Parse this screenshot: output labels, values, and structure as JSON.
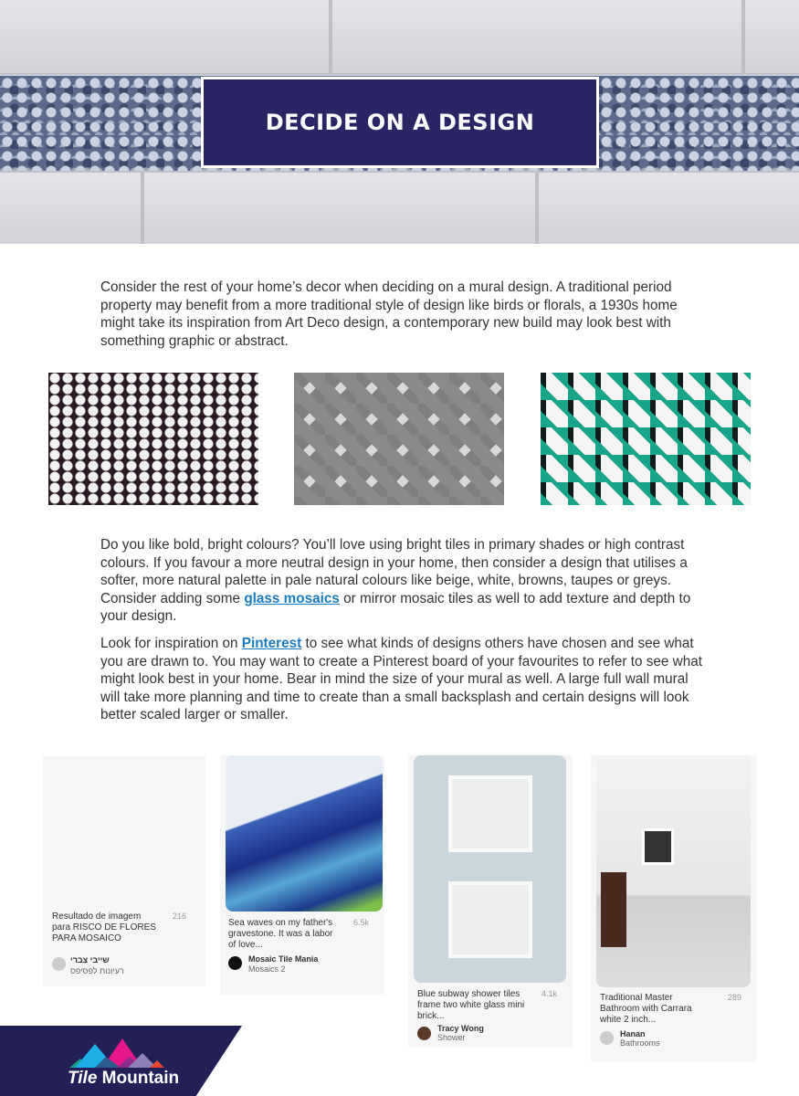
{
  "header": {
    "title": "DECIDE ON A DESIGN"
  },
  "paragraphs": {
    "p1": "Consider the rest of your home’s decor when deciding on a mural design. A traditional period property may benefit from a more traditional style of design like birds or florals, a 1930s home might take its inspiration from Art Deco design, a contemporary new build may look best with something graphic or abstract.",
    "p2_a": "Do you like bold, bright colours? You’ll love using bright tiles in primary shades or high contrast colours. If you favour a more neutral design in your home, then consider a design that utilises a softer, more natural palette in pale natural colours like beige, white, browns, taupes or greys. Consider adding some ",
    "p2_link": "glass mosaics",
    "p2_b": " or mirror mosaic tiles as well to add texture and depth to your design.",
    "p3_a": "Look for inspiration on ",
    "p3_link": "Pinterest",
    "p3_b": " to see what kinds of designs others have chosen and see what you are drawn to. You may want to create a Pinterest board of your favourites to refer to see what might look best in your home. Bear in mind the size of your mural as well. A large full wall mural will take more planning and time to create than a small backsplash and certain designs will look better scaled larger or smaller."
  },
  "pins": [
    {
      "caption": "Resultado de imagem para RISCO DE FLORES PARA MOSAICO",
      "count": "216",
      "user": "שייבי צברי",
      "board": "רעיונות לפסיפס"
    },
    {
      "caption": "Sea waves on my father's gravestone. It was a labor of love...",
      "count": "6.5k",
      "user": "Mosaic Tile Mania",
      "board": "Mosaics 2"
    },
    {
      "caption": "Blue subway shower tiles frame two white glass mini brick...",
      "count": "4.1k",
      "user": "Tracy Wong",
      "board": "Shower"
    },
    {
      "caption": "Traditional Master Bathroom with Carrara white 2 inch...",
      "count": "289",
      "user": "Hanan",
      "board": "Bathrooms"
    }
  ],
  "footer": {
    "logo_a": "Tile",
    "logo_b": " Mountain"
  },
  "colors": {
    "navy": "#2a2665",
    "link": "#1a7bbf"
  }
}
